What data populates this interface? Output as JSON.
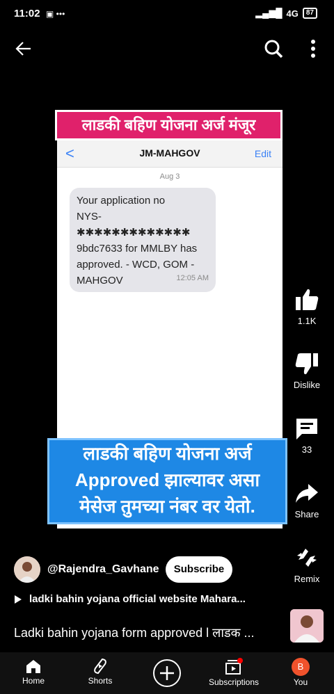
{
  "status_bar": {
    "time": "11:02",
    "network": "4G",
    "battery": "87"
  },
  "video": {
    "top_banner": "लाडकी बहिण योजना अर्ज मंजूर",
    "sms": {
      "back": "<",
      "sender": "JM-MAHGOV",
      "edit": "Edit",
      "date": "Aug 3",
      "message": "Your application no\nNYS-✱✱✱✱✱✱✱✱✱✱✱✱✱\n9bdc7633 for MMLBY has\napproved. - WCD, GOM -\nMAHGOV",
      "time": "12:05 AM"
    },
    "bottom_banner": {
      "line1": "लाडकी बहिण योजना अर्ज",
      "line2": "Approved झाल्यावर असा",
      "line3": "मेसेज तुमच्या नंबर वर येतो."
    }
  },
  "actions": {
    "like_count": "1.1K",
    "dislike_label": "Dislike",
    "comments_count": "33",
    "share_label": "Share",
    "remix_label": "Remix"
  },
  "channel": {
    "name": "@Rajendra_Gavhane",
    "subscribe_label": "Subscribe"
  },
  "playlist_text": "ladki bahin yojana official website Mahara...",
  "video_title": "Ladki bahin yojana form approved l लाडक ...",
  "nav": {
    "home": "Home",
    "shorts": "Shorts",
    "subscriptions": "Subscriptions",
    "you": "You",
    "you_initial": "B"
  },
  "colors": {
    "pink_banner": "#e0216b",
    "blue_banner": "#1e88e5",
    "you_avatar": "#f0522c",
    "notification": "#ff0000"
  }
}
